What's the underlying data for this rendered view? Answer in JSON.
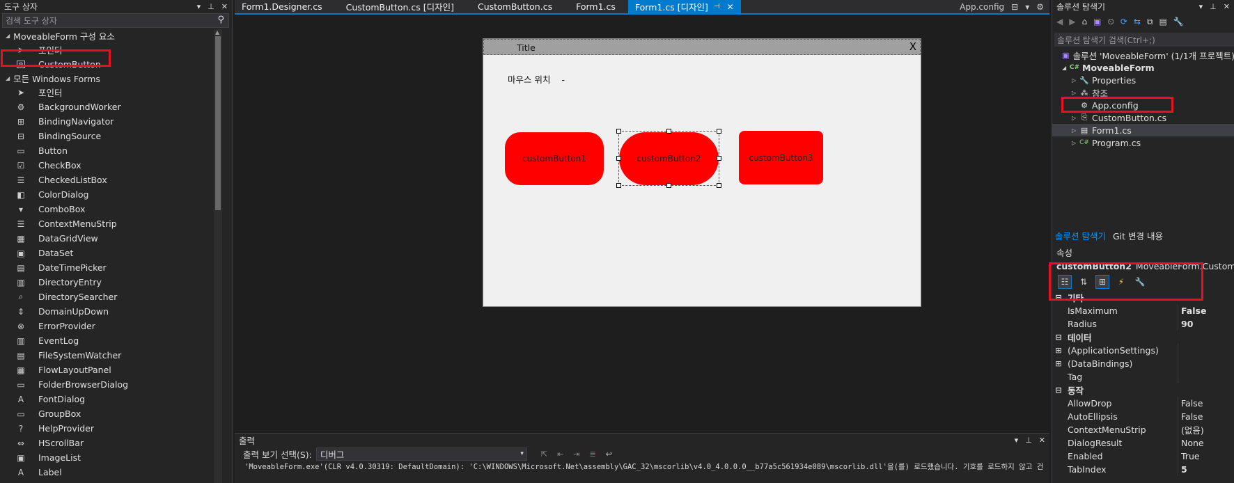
{
  "toolbox": {
    "title": "도구 상자",
    "search_placeholder": "검색 도구 상자",
    "group1": "MoveableForm 구성 요소",
    "group1_items": [
      "포인터",
      "CustomButton"
    ],
    "group2": "모든 Windows Forms",
    "group2_items": [
      "포인터",
      "BackgroundWorker",
      "BindingNavigator",
      "BindingSource",
      "Button",
      "CheckBox",
      "CheckedListBox",
      "ColorDialog",
      "ComboBox",
      "ContextMenuStrip",
      "DataGridView",
      "DataSet",
      "DateTimePicker",
      "DirectoryEntry",
      "DirectorySearcher",
      "DomainUpDown",
      "ErrorProvider",
      "EventLog",
      "FileSystemWatcher",
      "FlowLayoutPanel",
      "FolderBrowserDialog",
      "FontDialog",
      "GroupBox",
      "HelpProvider",
      "HScrollBar",
      "ImageList",
      "Label"
    ]
  },
  "tabs": {
    "items": [
      "Form1.Designer.cs",
      "CustomButton.cs [디자인]",
      "CustomButton.cs",
      "Form1.cs",
      "Form1.cs [디자인]"
    ],
    "right_tab": "App.config"
  },
  "designer": {
    "form_title": "Title",
    "close_glyph": "X",
    "mouse_label": "마우스 위치",
    "mouse_value": "-",
    "buttons": [
      "customButton1",
      "customButton2",
      "customButton3"
    ]
  },
  "output": {
    "title": "출력",
    "select_label": "출력 보기 선택(S):",
    "select_value": "디버그",
    "log_line": "'MoveableForm.exe'(CLR v4.0.30319: DefaultDomain): 'C:\\WINDOWS\\Microsoft.Net\\assembly\\GAC_32\\mscorlib\\v4.0_4.0.0.0__b77a5c561934e089\\mscorlib.dll'을(를) 로드했습니다. 기호를 로드하지 않고 건"
  },
  "solution": {
    "title": "솔루션 탐색기",
    "search_placeholder": "솔루션 탐색기 검색(Ctrl+;)",
    "root": "솔루션 'MoveableForm' (1/1개 프로젝트)",
    "project": "MoveableForm",
    "items": [
      "Properties",
      "참조",
      "App.config",
      "CustomButton.cs",
      "Form1.cs",
      "Program.cs"
    ],
    "tab_active": "솔루션 탐색기",
    "tab_other": "Git 변경 내용"
  },
  "properties": {
    "title": "속성",
    "object_name": "customButton2",
    "object_type": "MoveableForm.CustomButton",
    "rows": [
      {
        "kind": "cat",
        "name": "기타"
      },
      {
        "kind": "prop",
        "name": "IsMaximum",
        "value": "False",
        "bold": true
      },
      {
        "kind": "prop",
        "name": "Radius",
        "value": "90",
        "bold": true
      },
      {
        "kind": "cat",
        "name": "데이터"
      },
      {
        "kind": "prop",
        "name": "(ApplicationSettings)",
        "value": "",
        "expand": true
      },
      {
        "kind": "prop",
        "name": "(DataBindings)",
        "value": "",
        "expand": true
      },
      {
        "kind": "prop",
        "name": "Tag",
        "value": ""
      },
      {
        "kind": "cat",
        "name": "동작"
      },
      {
        "kind": "prop",
        "name": "AllowDrop",
        "value": "False"
      },
      {
        "kind": "prop",
        "name": "AutoEllipsis",
        "value": "False"
      },
      {
        "kind": "prop",
        "name": "ContextMenuStrip",
        "value": "(없음)"
      },
      {
        "kind": "prop",
        "name": "DialogResult",
        "value": "None"
      },
      {
        "kind": "prop",
        "name": "Enabled",
        "value": "True"
      },
      {
        "kind": "prop",
        "name": "TabIndex",
        "value": "5",
        "bold": true
      }
    ]
  },
  "colors": {
    "accent": "#007acc",
    "button_fill": "#ff0000",
    "highlight_box": "#e81123"
  }
}
